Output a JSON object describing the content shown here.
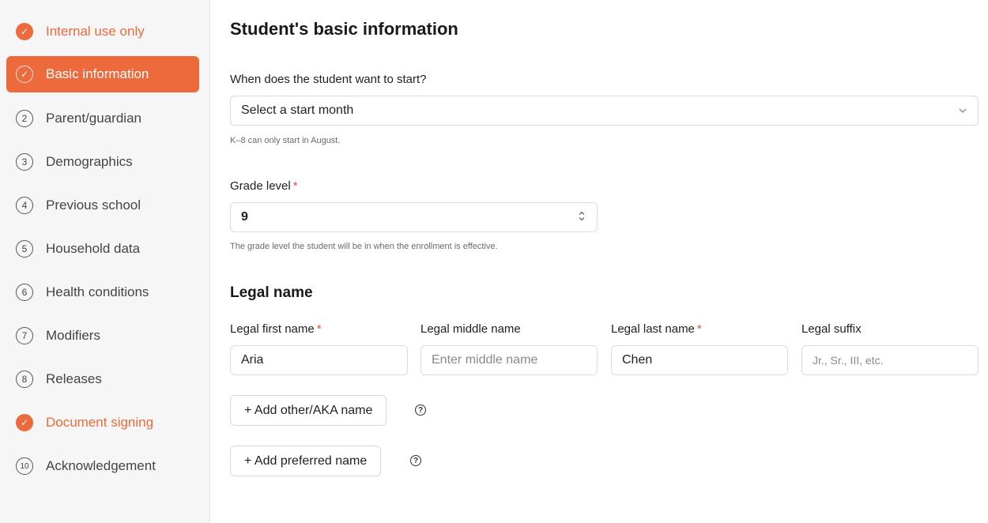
{
  "sidebar": {
    "items": [
      {
        "badge": "✓",
        "label": "Internal use only",
        "state": "done"
      },
      {
        "badge": "✓",
        "label": "Basic information",
        "state": "active"
      },
      {
        "badge": "2",
        "label": "Parent/guardian",
        "state": "pending"
      },
      {
        "badge": "3",
        "label": "Demographics",
        "state": "pending"
      },
      {
        "badge": "4",
        "label": "Previous school",
        "state": "pending"
      },
      {
        "badge": "5",
        "label": "Household data",
        "state": "pending"
      },
      {
        "badge": "6",
        "label": "Health conditions",
        "state": "pending"
      },
      {
        "badge": "7",
        "label": "Modifiers",
        "state": "pending"
      },
      {
        "badge": "8",
        "label": "Releases",
        "state": "pending"
      },
      {
        "badge": "✓",
        "label": "Document signing",
        "state": "done"
      },
      {
        "badge": "10",
        "label": "Acknowledgement",
        "state": "pending"
      }
    ]
  },
  "main": {
    "title": "Student's basic information",
    "start": {
      "label": "When does the student want to start?",
      "selected": "Select a start month",
      "helper": "K–8 can only start in August."
    },
    "grade": {
      "label": "Grade level",
      "required": "*",
      "value": "9",
      "helper": "The grade level the student will be in when the enrollment is effective."
    },
    "legal": {
      "title": "Legal name",
      "first": {
        "label": "Legal first name",
        "required": "*",
        "value": "Aria",
        "placeholder": ""
      },
      "middle": {
        "label": "Legal middle name",
        "value": "",
        "placeholder": "Enter middle name"
      },
      "last": {
        "label": "Legal last name",
        "required": "*",
        "value": "Chen",
        "placeholder": ""
      },
      "suffix": {
        "label": "Legal suffix",
        "value": "",
        "placeholder": "Jr., Sr., III, etc."
      }
    },
    "buttons": {
      "add_aka": "+ Add other/AKA name",
      "add_preferred": "+ Add preferred name"
    },
    "help_glyph": "?"
  },
  "colors": {
    "accent": "#ec6a3c",
    "required": "#e5533a",
    "sidebar_bg": "#f6f6f6"
  },
  "icons": {
    "check": "check-icon",
    "step": "step-number-icon",
    "select": "chevron-down-icon",
    "stepper": "up-down-chevron-icon",
    "help": "question-circle-icon"
  }
}
